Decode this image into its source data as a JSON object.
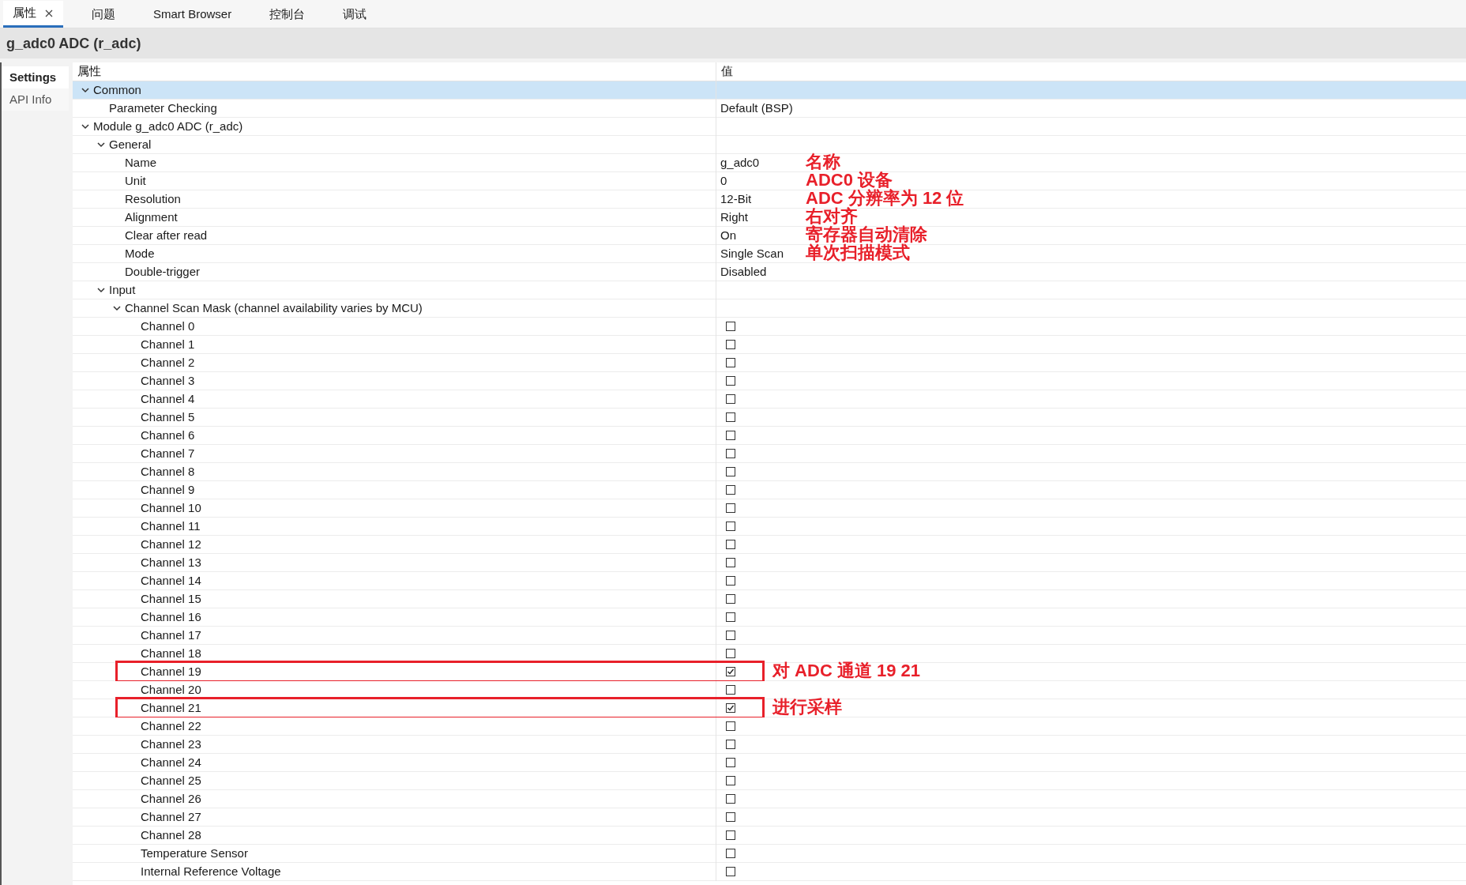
{
  "tabs": [
    {
      "label": "属性",
      "selected": true,
      "closable": true
    },
    {
      "label": "问题",
      "selected": false
    },
    {
      "label": "Smart Browser",
      "selected": false
    },
    {
      "label": "控制台",
      "selected": false
    },
    {
      "label": "调试",
      "selected": false
    }
  ],
  "title": "g_adc0 ADC (r_adc)",
  "side_tabs": [
    {
      "label": "Settings",
      "selected": true
    },
    {
      "label": "API Info",
      "selected": false
    }
  ],
  "columns": [
    "属性",
    "值"
  ],
  "tree": [
    {
      "label": "Common",
      "expanded": true,
      "selected": true,
      "children": [
        {
          "label": "Parameter Checking",
          "kind": "text",
          "value": "Default (BSP)"
        }
      ]
    },
    {
      "label": "Module g_adc0 ADC (r_adc)",
      "expanded": true,
      "selected": false,
      "children": [
        {
          "label": "General",
          "expanded": true,
          "selected": false,
          "children": [
            {
              "label": "Name",
              "kind": "text",
              "value": "g_adc0",
              "note": "名称"
            },
            {
              "label": "Unit",
              "kind": "text",
              "value": "0",
              "note": "ADC0 设备"
            },
            {
              "label": "Resolution",
              "kind": "text",
              "value": "12-Bit",
              "note": "ADC 分辨率为 12 位"
            },
            {
              "label": "Alignment",
              "kind": "text",
              "value": "Right",
              "note": "右对齐"
            },
            {
              "label": "Clear after read",
              "kind": "text",
              "value": "On",
              "note": "寄存器自动清除"
            },
            {
              "label": "Mode",
              "kind": "text",
              "value": "Single Scan",
              "note": "单次扫描模式"
            },
            {
              "label": "Double-trigger",
              "kind": "text",
              "value": "Disabled"
            }
          ]
        },
        {
          "label": "Input",
          "expanded": true,
          "selected": false,
          "children": [
            {
              "label": "Channel Scan Mask (channel availability varies by MCU)",
              "expanded": true,
              "selected": false,
              "children": [
                {
                  "label": "Channel 0",
                  "kind": "checkbox",
                  "checked": false
                },
                {
                  "label": "Channel 1",
                  "kind": "checkbox",
                  "checked": false
                },
                {
                  "label": "Channel 2",
                  "kind": "checkbox",
                  "checked": false
                },
                {
                  "label": "Channel 3",
                  "kind": "checkbox",
                  "checked": false
                },
                {
                  "label": "Channel 4",
                  "kind": "checkbox",
                  "checked": false
                },
                {
                  "label": "Channel 5",
                  "kind": "checkbox",
                  "checked": false
                },
                {
                  "label": "Channel 6",
                  "kind": "checkbox",
                  "checked": false
                },
                {
                  "label": "Channel 7",
                  "kind": "checkbox",
                  "checked": false
                },
                {
                  "label": "Channel 8",
                  "kind": "checkbox",
                  "checked": false
                },
                {
                  "label": "Channel 9",
                  "kind": "checkbox",
                  "checked": false
                },
                {
                  "label": "Channel 10",
                  "kind": "checkbox",
                  "checked": false
                },
                {
                  "label": "Channel 11",
                  "kind": "checkbox",
                  "checked": false
                },
                {
                  "label": "Channel 12",
                  "kind": "checkbox",
                  "checked": false
                },
                {
                  "label": "Channel 13",
                  "kind": "checkbox",
                  "checked": false
                },
                {
                  "label": "Channel 14",
                  "kind": "checkbox",
                  "checked": false
                },
                {
                  "label": "Channel 15",
                  "kind": "checkbox",
                  "checked": false
                },
                {
                  "label": "Channel 16",
                  "kind": "checkbox",
                  "checked": false
                },
                {
                  "label": "Channel 17",
                  "kind": "checkbox",
                  "checked": false
                },
                {
                  "label": "Channel 18",
                  "kind": "checkbox",
                  "checked": false
                },
                {
                  "label": "Channel 19",
                  "kind": "checkbox",
                  "checked": true,
                  "highlighted": true,
                  "note": "对 ADC 通道 19 21"
                },
                {
                  "label": "Channel 20",
                  "kind": "checkbox",
                  "checked": false
                },
                {
                  "label": "Channel 21",
                  "kind": "checkbox",
                  "checked": true,
                  "highlighted": true,
                  "note": "进行采样"
                },
                {
                  "label": "Channel 22",
                  "kind": "checkbox",
                  "checked": false
                },
                {
                  "label": "Channel 23",
                  "kind": "checkbox",
                  "checked": false
                },
                {
                  "label": "Channel 24",
                  "kind": "checkbox",
                  "checked": false
                },
                {
                  "label": "Channel 25",
                  "kind": "checkbox",
                  "checked": false
                },
                {
                  "label": "Channel 26",
                  "kind": "checkbox",
                  "checked": false
                },
                {
                  "label": "Channel 27",
                  "kind": "checkbox",
                  "checked": false
                },
                {
                  "label": "Channel 28",
                  "kind": "checkbox",
                  "checked": false
                },
                {
                  "label": "Temperature Sensor",
                  "kind": "checkbox",
                  "checked": false
                },
                {
                  "label": "Internal Reference Voltage",
                  "kind": "checkbox",
                  "checked": false
                }
              ]
            }
          ]
        }
      ]
    }
  ]
}
